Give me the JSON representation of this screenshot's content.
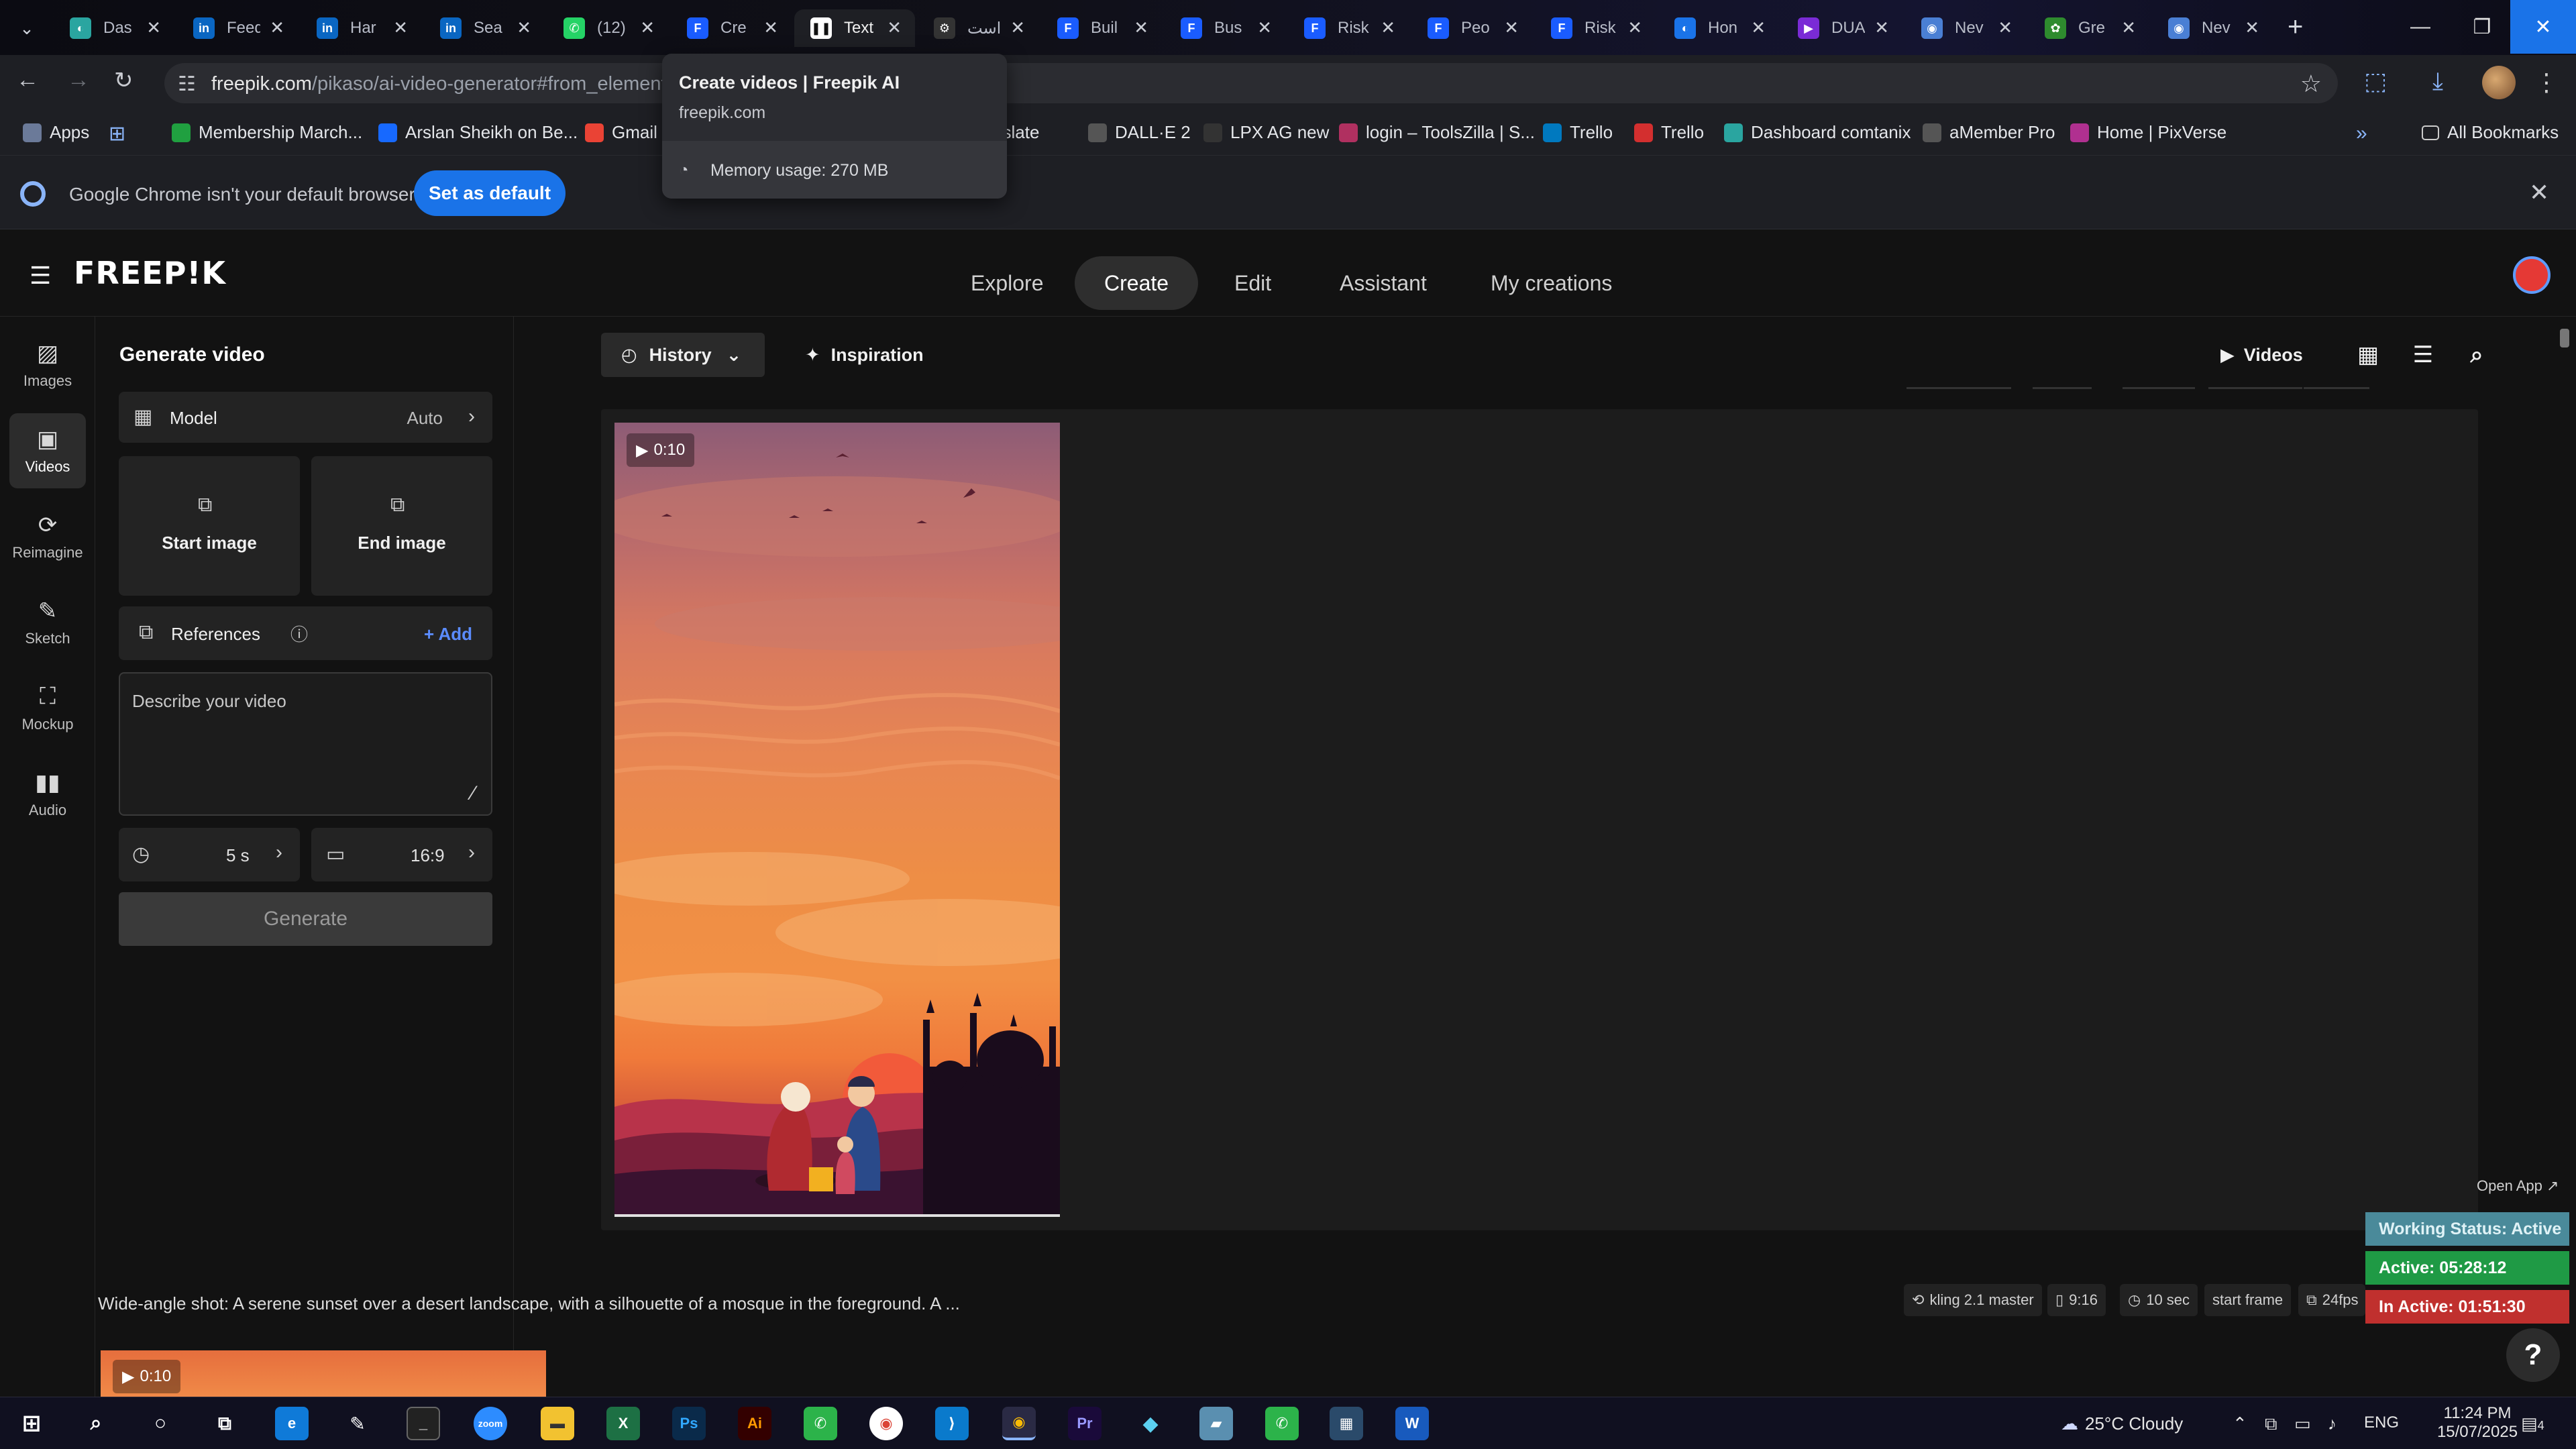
{
  "browser": {
    "tabs": [
      {
        "label": "Das",
        "icon": "app-icon",
        "color": "#2aa5a0"
      },
      {
        "label": "Feed",
        "icon": "linkedin-icon",
        "color": "#0a66c2"
      },
      {
        "label": "Har",
        "icon": "linkedin-icon",
        "color": "#0a66c2"
      },
      {
        "label": "Sea",
        "icon": "linkedin-icon",
        "color": "#0a66c2"
      },
      {
        "label": "(12)",
        "icon": "whatsapp-icon",
        "color": "#25d366"
      },
      {
        "label": "Cre",
        "icon": "freepik-icon",
        "color": "#1a5cff"
      },
      {
        "label": "Text",
        "icon": "pause-icon",
        "color": "#ffffff"
      },
      {
        "label": "است",
        "icon": "gear-icon",
        "color": "#333333"
      },
      {
        "label": "Buil",
        "icon": "freepik-icon",
        "color": "#1a5cff"
      },
      {
        "label": "Bus",
        "icon": "freepik-icon",
        "color": "#1a5cff"
      },
      {
        "label": "Risk",
        "icon": "freepik-icon",
        "color": "#1a5cff"
      },
      {
        "label": "Peo",
        "icon": "freepik-icon",
        "color": "#1a5cff"
      },
      {
        "label": "Risk",
        "icon": "freepik-icon",
        "color": "#1a5cff"
      },
      {
        "label": "Hon",
        "icon": "app-icon",
        "color": "#1a73e8"
      },
      {
        "label": "DUA",
        "icon": "video-icon",
        "color": "#7a2bd6"
      },
      {
        "label": "Nev",
        "icon": "chrome-icon",
        "color": "#4a7fd4"
      },
      {
        "label": "Gre",
        "icon": "palm-icon",
        "color": "#2e8b2e"
      },
      {
        "label": "Nev",
        "icon": "chrome-icon",
        "color": "#4a7fd4"
      }
    ],
    "active_tab_index": 6,
    "url_host": "freepik.com",
    "url_path": "/pikaso/ai-video-generator#from_element=",
    "bookmarks": [
      {
        "label": "Apps",
        "color": "#6b7a99"
      },
      {
        "label": "Membership March...",
        "color": "#20a040"
      },
      {
        "label": "Arslan Sheikh on Be...",
        "color": "#1769ff"
      },
      {
        "label": "Gmail",
        "color": "#ea4335"
      },
      {
        "label": "Translate",
        "color": "#4285f4"
      },
      {
        "label": "DALL·E 2",
        "color": "#555555"
      },
      {
        "label": "LPX AG new",
        "color": "#333333"
      },
      {
        "label": "login – ToolsZilla | S...",
        "color": "#b03060"
      },
      {
        "label": "Trello",
        "color": "#0079bf"
      },
      {
        "label": "Trello",
        "color": "#d32f2f"
      },
      {
        "label": "Dashboard comtanix",
        "color": "#2aa5a0"
      },
      {
        "label": "aMember Pro",
        "color": "#555555"
      },
      {
        "label": "Home | PixVerse",
        "color": "#b03090"
      }
    ],
    "all_bookmarks": "All Bookmarks",
    "infobar_message": "Google Chrome isn't your default browser",
    "infobar_button": "Set as default",
    "tooltip": {
      "title": "Create videos | Freepik AI",
      "host": "freepik.com",
      "memory": "Memory usage: 270 MB"
    }
  },
  "app": {
    "logo": "FREEP!K",
    "nav": [
      "Explore",
      "Create",
      "Edit",
      "Assistant",
      "My creations"
    ],
    "nav_active": "Create",
    "rail": [
      {
        "label": "Images",
        "icon": "images-icon"
      },
      {
        "label": "Videos",
        "icon": "videos-icon"
      },
      {
        "label": "Reimagine",
        "icon": "reimagine-icon"
      },
      {
        "label": "Sketch",
        "icon": "sketch-icon"
      },
      {
        "label": "Mockup",
        "icon": "mockup-icon"
      },
      {
        "label": "Audio",
        "icon": "audio-icon"
      }
    ],
    "panel": {
      "title": "Generate video",
      "model_label": "Model",
      "model_value": "Auto",
      "start_image": "Start image",
      "end_image": "End image",
      "references_label": "References",
      "add_label": "+ Add",
      "prompt_placeholder": "Describe your video",
      "duration": "5 s",
      "aspect": "16:9",
      "generate": "Generate"
    },
    "toolbar": {
      "history": "History",
      "inspiration": "Inspiration",
      "videos": "Videos"
    },
    "result": {
      "duration_badge": "0:10",
      "prompt": "Wide-angle shot: A serene sunset over a desert landscape, with a silhouette of a mosque in the foreground. A ...",
      "meta": [
        "kling 2.1 master",
        "9:16",
        "10 sec",
        "start frame",
        "24fps"
      ],
      "second_badge": "0:10"
    },
    "open_app": "Open App ↗",
    "status": {
      "working": "Working Status: Active",
      "active": "Active: 05:28:12",
      "inactive": "In Active: 01:51:30"
    }
  },
  "taskbar": {
    "weather": "25°C  Cloudy",
    "lang": "ENG",
    "time": "11:24 PM",
    "date": "15/07/2025",
    "notifications": "4"
  }
}
